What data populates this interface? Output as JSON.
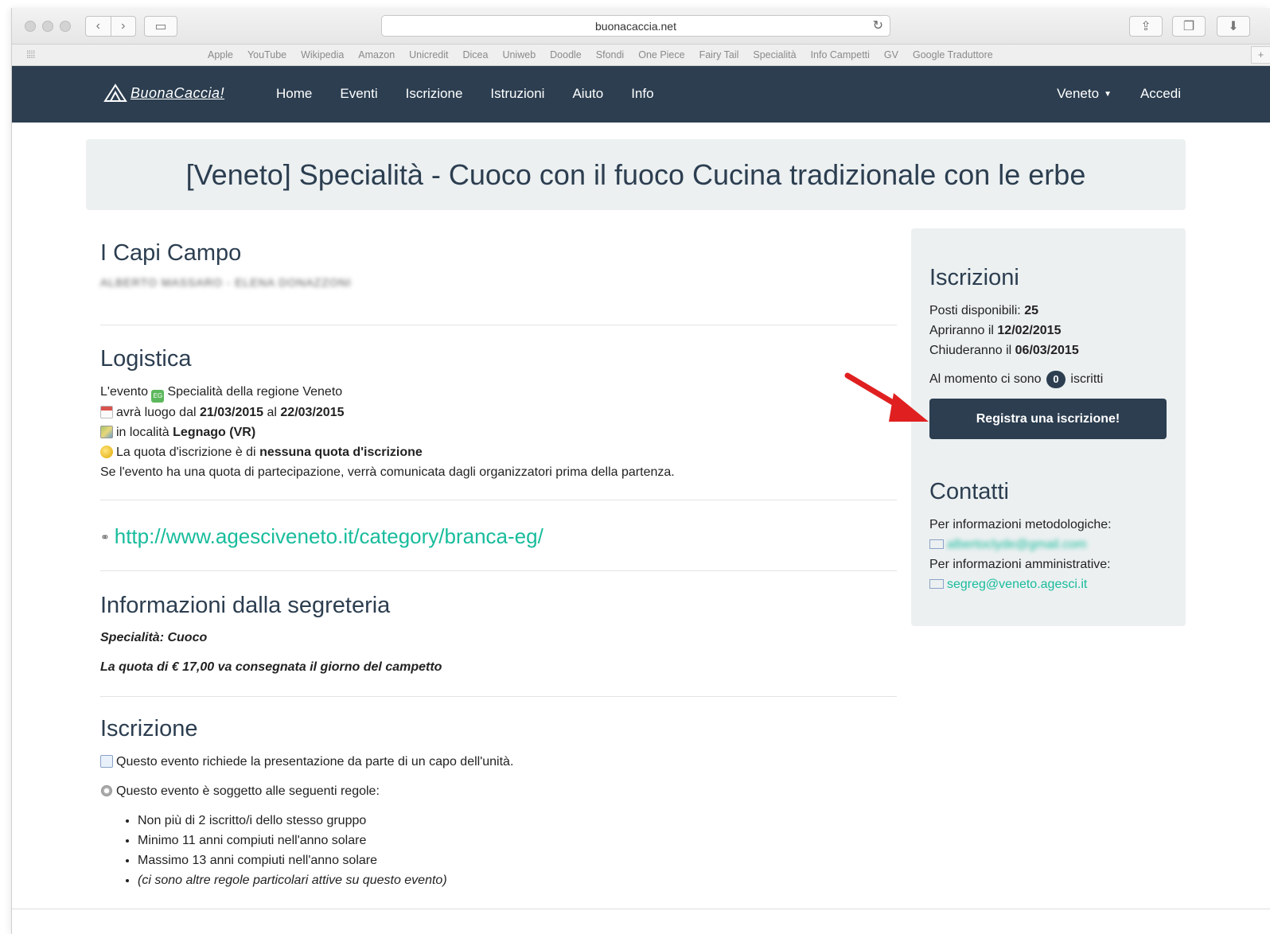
{
  "browser": {
    "url": "buonacaccia.net",
    "bookmarks": [
      "Apple",
      "YouTube",
      "Wikipedia",
      "Amazon",
      "Unicredit",
      "Dicea",
      "Uniweb",
      "Doodle",
      "Sfondi",
      "One Piece",
      "Fairy Tail",
      "Specialità",
      "Info Campetti",
      "GV",
      "Google Traduttore"
    ]
  },
  "navbar": {
    "brand": "BuonaCaccia!",
    "items": [
      "Home",
      "Eventi",
      "Iscrizione",
      "Istruzioni",
      "Aiuto",
      "Info"
    ],
    "region": "Veneto",
    "login": "Accedi"
  },
  "page": {
    "title": "[Veneto] Specialità - Cuoco con il fuoco Cucina tradizionale con le erbe"
  },
  "capi": {
    "heading": "I Capi Campo",
    "names": "ALBERTO MASSARO - ELENA DONAZZONI"
  },
  "logistica": {
    "heading": "Logistica",
    "evento_prefix": "L'evento",
    "evento_badge": "EG",
    "evento_text": "Specialità della regione Veneto",
    "date_prefix": "avrà luogo dal",
    "date_from": "21/03/2015",
    "date_mid": "al",
    "date_to": "22/03/2015",
    "place_prefix": "in località",
    "place": "Legnago (VR)",
    "quota_prefix": "La quota d'iscrizione è di",
    "quota": "nessuna quota d'iscrizione",
    "note": "Se l'evento ha una quota di partecipazione, verrà comunicata dagli organizzatori prima della partenza."
  },
  "link": {
    "url": "http://www.agesciveneto.it/category/branca-eg/"
  },
  "segreteria": {
    "heading": "Informazioni dalla segreteria",
    "line1": "Specialità: Cuoco",
    "line2": "La quota di € 17,00 va consegnata il giorno del campetto"
  },
  "iscrizione": {
    "heading": "Iscrizione",
    "presentazione": "Questo evento richiede la presentazione da parte di un capo dell'unità.",
    "regole_intro": "Questo evento è soggetto alle seguenti regole:",
    "rules": [
      "Non più di 2 iscritto/i dello stesso gruppo",
      "Minimo 11 anni compiuti nell'anno solare",
      "Massimo 13 anni compiuti nell'anno solare",
      "(ci sono altre regole particolari attive su questo evento)"
    ]
  },
  "sidebar": {
    "iscrizioni_heading": "Iscrizioni",
    "posti_label": "Posti disponibili:",
    "posti_value": "25",
    "apertura_label": "Apriranno il",
    "apertura_value": "12/02/2015",
    "chiusura_label": "Chiuderanno il",
    "chiusura_value": "06/03/2015",
    "iscritti_prefix": "Al momento ci sono",
    "iscritti_count": "0",
    "iscritti_suffix": "iscritti",
    "button": "Registra una iscrizione!",
    "contatti_heading": "Contatti",
    "metodologiche_label": "Per informazioni metodologiche:",
    "metodologiche_email": "albertoclyde@gmail.com",
    "amministrative_label": "Per informazioni amministrative:",
    "amministrative_email": "segreg@veneto.agesci.it"
  },
  "colors": {
    "navbar": "#2c3e50",
    "link": "#18bc9c",
    "panel": "#ecf0f1",
    "arrow": "#e02020"
  }
}
